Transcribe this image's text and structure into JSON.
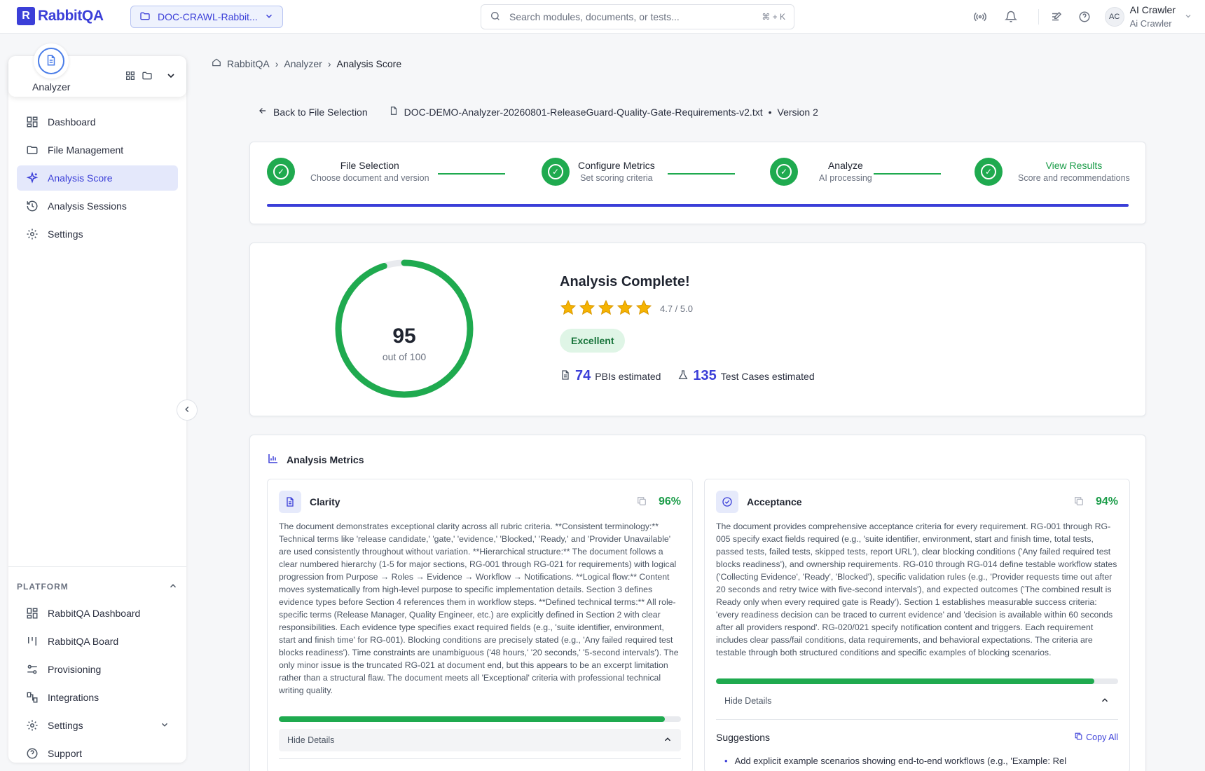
{
  "brand": {
    "name": "RabbitQA",
    "mark": "R"
  },
  "topbar": {
    "doc_selector": "DOC-CRAWL-Rabbit...",
    "search_placeholder": "Search modules, documents, or tests...",
    "search_shortcut": "⌘ + K",
    "user": {
      "initials": "AC",
      "name": "AI Crawler",
      "role": "Ai Crawler"
    }
  },
  "sidebar": {
    "module": "Analyzer",
    "items": [
      {
        "label": "Dashboard",
        "icon": "dashboard-icon"
      },
      {
        "label": "File Management",
        "icon": "folder-icon"
      },
      {
        "label": "Analysis Score",
        "icon": "sparkle-icon",
        "active": true
      },
      {
        "label": "Analysis Sessions",
        "icon": "history-icon"
      },
      {
        "label": "Settings",
        "icon": "gear-icon"
      }
    ],
    "platform": {
      "heading": "PLATFORM",
      "items": [
        {
          "label": "RabbitQA Dashboard"
        },
        {
          "label": "RabbitQA Board"
        },
        {
          "label": "Provisioning"
        },
        {
          "label": "Integrations"
        },
        {
          "label": "Settings"
        },
        {
          "label": "Support"
        }
      ]
    }
  },
  "breadcrumb": [
    "RabbitQA",
    "Analyzer",
    "Analysis Score"
  ],
  "file_row": {
    "back": "Back to File Selection",
    "file_name": "DOC-DEMO-Analyzer-20260801-ReleaseGuard-Quality-Gate-Requirements-v2.txt",
    "separator": "•",
    "version": "Version 2"
  },
  "stepper": [
    {
      "title": "File Selection",
      "sub": "Choose document and version"
    },
    {
      "title": "Configure Metrics",
      "sub": "Set scoring criteria"
    },
    {
      "title": "Analyze",
      "sub": "AI processing"
    },
    {
      "title": "View Results",
      "sub": "Score and recommendations"
    }
  ],
  "score": {
    "value": "95",
    "out_of": "out of 100",
    "fraction": 0.95,
    "title": "Analysis Complete!",
    "rating": "4.7 / 5.0",
    "stars": 5,
    "badge": "Excellent",
    "pbis": "74",
    "pbis_label": "PBIs estimated",
    "tests": "135",
    "tests_label": "Test Cases estimated"
  },
  "metrics": {
    "heading": "Analysis Metrics",
    "clarity": {
      "title": "Clarity",
      "pct": "96%",
      "fraction": 0.96,
      "text": "The document demonstrates exceptional clarity across all rubric criteria. **Consistent terminology:** Technical terms like 'release candidate,' 'gate,' 'evidence,' 'Blocked,' 'Ready,' and 'Provider Unavailable' are used consistently throughout without variation. **Hierarchical structure:** The document follows a clear numbered hierarchy (1-5 for major sections, RG-001 through RG-021 for requirements) with logical progression from Purpose → Roles → Evidence → Workflow → Notifications. **Logical flow:** Content moves systematically from high-level purpose to specific implementation details. Section 3 defines evidence types before Section 4 references them in workflow steps. **Defined technical terms:** All role-specific terms (Release Manager, Quality Engineer, etc.) are explicitly defined in Section 2 with clear responsibilities. Each evidence type specifies exact required fields (e.g., 'suite identifier, environment, start and finish time' for RG-001). Blocking conditions are precisely stated (e.g., 'Any failed required test blocks readiness'). Time constraints are unambiguous ('48 hours,' '20 seconds,' '5-second intervals'). The only minor issue is the truncated RG-021 at document end, but this appears to be an excerpt limitation rather than a structural flaw. The document meets all 'Exceptional' criteria with professional technical writing quality.",
      "hide": "Hide Details"
    },
    "acceptance": {
      "title": "Acceptance",
      "pct": "94%",
      "fraction": 0.94,
      "text": "The document provides comprehensive acceptance criteria for every requirement. RG-001 through RG-005 specify exact fields required (e.g., 'suite identifier, environment, start and finish time, total tests, passed tests, failed tests, skipped tests, report URL'), clear blocking conditions ('Any failed required test blocks readiness'), and ownership requirements. RG-010 through RG-014 define testable workflow states ('Collecting Evidence', 'Ready', 'Blocked'), specific validation rules (e.g., 'Provider requests time out after 20 seconds and retry twice with five-second intervals'), and expected outcomes ('The combined result is Ready only when every required gate is Ready'). Section 1 establishes measurable success criteria: 'every readiness decision can be traced to current evidence' and 'decision is available within 60 seconds after all providers respond'. RG-020/021 specify notification content and triggers. Each requirement includes clear pass/fail conditions, data requirements, and behavioral expectations. The criteria are testable through both structured conditions and specific examples of blocking scenarios.",
      "hide": "Hide Details",
      "suggestions_heading": "Suggestions",
      "copy_all": "Copy All",
      "suggestion_1": "Add explicit example scenarios showing end-to-end workflows (e.g., 'Example: Rel"
    }
  },
  "colors": {
    "accent": "#3b3fd8",
    "success": "#1faa4f",
    "star": "#f5b301"
  }
}
